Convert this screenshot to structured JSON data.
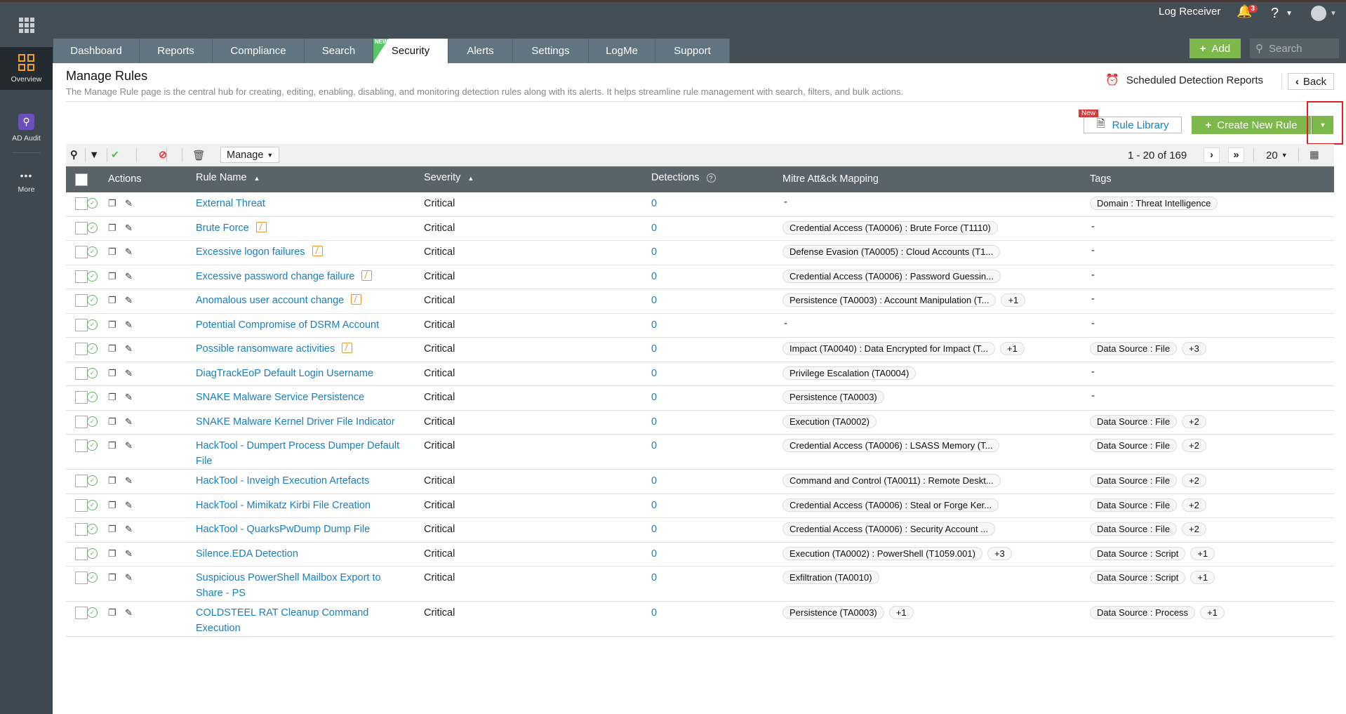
{
  "header": {
    "log_receiver": "Log Receiver",
    "notification_count": "3",
    "help": "?",
    "add_label": "Add",
    "search_placeholder": "Search"
  },
  "sidebar": {
    "items": [
      {
        "label": "Overview",
        "icon": "grid-icon",
        "active": true
      },
      {
        "label": "AD Audit",
        "icon": "ad-audit-icon"
      },
      {
        "label": "More",
        "icon": "more-icon"
      }
    ]
  },
  "tabs": [
    {
      "label": "Dashboard"
    },
    {
      "label": "Reports"
    },
    {
      "label": "Compliance"
    },
    {
      "label": "Search"
    },
    {
      "label": "Security",
      "active": true,
      "badge": "NEW"
    },
    {
      "label": "Alerts"
    },
    {
      "label": "Settings"
    },
    {
      "label": "LogMe"
    },
    {
      "label": "Support"
    }
  ],
  "page": {
    "title": "Manage Rules",
    "description": "The Manage Rule page is the central hub for creating, editing, enabling, disabling, and monitoring detection rules along with its alerts. It helps streamline rule management with search, filters, and bulk actions.",
    "scheduled_reports": "Scheduled Detection Reports",
    "back": "Back",
    "rule_library": "Rule Library",
    "rule_library_badge": "New",
    "create_rule": "Create New Rule"
  },
  "toolbar": {
    "manage": "Manage",
    "pagination": "1 - 20 of 169",
    "page_size": "20"
  },
  "columns": {
    "actions": "Actions",
    "rule_name": "Rule Name",
    "severity": "Severity",
    "detections": "Detections",
    "mitre": "Mitre Att&ck Mapping",
    "tags": "Tags"
  },
  "colors": {
    "accent_green": "#7cb84a",
    "link": "#1a7fc1",
    "header": "#434e56",
    "highlight": "#e02020"
  },
  "rows": [
    {
      "name": "External Threat",
      "threat": false,
      "severity": "Critical",
      "detections": "0",
      "mitre": [],
      "mitre_more": "",
      "tags": [
        "Domain : Threat Intelligence"
      ],
      "tags_more": ""
    },
    {
      "name": "Brute Force",
      "threat": true,
      "severity": "Critical",
      "detections": "0",
      "mitre": [
        "Credential Access (TA0006) : Brute Force (T1110)"
      ],
      "mitre_more": "",
      "tags": [],
      "tags_more": ""
    },
    {
      "name": "Excessive logon failures",
      "threat": true,
      "severity": "Critical",
      "detections": "0",
      "mitre": [
        "Defense Evasion (TA0005) : Cloud Accounts (T1..."
      ],
      "mitre_more": "",
      "tags": [],
      "tags_more": ""
    },
    {
      "name": "Excessive password change failure",
      "threat": true,
      "severity": "Critical",
      "detections": "0",
      "mitre": [
        "Credential Access (TA0006) : Password Guessin..."
      ],
      "mitre_more": "",
      "tags": [],
      "tags_more": ""
    },
    {
      "name": "Anomalous user account change",
      "threat": true,
      "severity": "Critical",
      "detections": "0",
      "mitre": [
        "Persistence (TA0003) : Account Manipulation (T..."
      ],
      "mitre_more": "+1",
      "tags": [],
      "tags_more": ""
    },
    {
      "name": "Potential Compromise of DSRM Account",
      "threat": false,
      "severity": "Critical",
      "detections": "0",
      "mitre": [],
      "mitre_more": "",
      "tags": [],
      "tags_more": ""
    },
    {
      "name": "Possible ransomware activities",
      "threat": true,
      "severity": "Critical",
      "detections": "0",
      "mitre": [
        "Impact (TA0040) : Data Encrypted for Impact (T..."
      ],
      "mitre_more": "+1",
      "tags": [
        "Data Source : File"
      ],
      "tags_more": "+3"
    },
    {
      "name": "DiagTrackEoP Default Login Username",
      "threat": false,
      "severity": "Critical",
      "detections": "0",
      "mitre": [
        "Privilege Escalation (TA0004)"
      ],
      "mitre_more": "",
      "tags": [],
      "tags_more": ""
    },
    {
      "name": "SNAKE Malware Service Persistence",
      "threat": false,
      "severity": "Critical",
      "detections": "0",
      "mitre": [
        "Persistence (TA0003)"
      ],
      "mitre_more": "",
      "tags": [],
      "tags_more": ""
    },
    {
      "name": "SNAKE Malware Kernel Driver File Indicator",
      "threat": false,
      "severity": "Critical",
      "detections": "0",
      "mitre": [
        "Execution (TA0002)"
      ],
      "mitre_more": "",
      "tags": [
        "Data Source : File"
      ],
      "tags_more": "+2"
    },
    {
      "name": "HackTool - Dumpert Process Dumper Default File",
      "threat": false,
      "severity": "Critical",
      "detections": "0",
      "mitre": [
        "Credential Access (TA0006) : LSASS Memory (T..."
      ],
      "mitre_more": "",
      "tags": [
        "Data Source : File"
      ],
      "tags_more": "+2"
    },
    {
      "name": "HackTool - Inveigh Execution Artefacts",
      "threat": false,
      "severity": "Critical",
      "detections": "0",
      "mitre": [
        "Command and Control (TA0011) : Remote Deskt..."
      ],
      "mitre_more": "",
      "tags": [
        "Data Source : File"
      ],
      "tags_more": "+2"
    },
    {
      "name": "HackTool - Mimikatz Kirbi File Creation",
      "threat": false,
      "severity": "Critical",
      "detections": "0",
      "mitre": [
        "Credential Access (TA0006) : Steal or Forge Ker..."
      ],
      "mitre_more": "",
      "tags": [
        "Data Source : File"
      ],
      "tags_more": "+2"
    },
    {
      "name": "HackTool - QuarksPwDump Dump File",
      "threat": false,
      "severity": "Critical",
      "detections": "0",
      "mitre": [
        "Credential Access (TA0006) : Security Account ..."
      ],
      "mitre_more": "",
      "tags": [
        "Data Source : File"
      ],
      "tags_more": "+2"
    },
    {
      "name": "Silence.EDA Detection",
      "threat": false,
      "severity": "Critical",
      "detections": "0",
      "mitre": [
        "Execution (TA0002) : PowerShell (T1059.001)"
      ],
      "mitre_more": "+3",
      "tags": [
        "Data Source : Script"
      ],
      "tags_more": "+1"
    },
    {
      "name": "Suspicious PowerShell Mailbox Export to Share - PS",
      "threat": false,
      "severity": "Critical",
      "detections": "0",
      "mitre": [
        "Exfiltration (TA0010)"
      ],
      "mitre_more": "",
      "tags": [
        "Data Source : Script"
      ],
      "tags_more": "+1"
    },
    {
      "name": "COLDSTEEL RAT Cleanup Command Execution",
      "threat": false,
      "severity": "Critical",
      "detections": "0",
      "mitre": [
        "Persistence (TA0003)"
      ],
      "mitre_more": "+1",
      "tags": [
        "Data Source : Process"
      ],
      "tags_more": "+1"
    }
  ],
  "empty_value": "-"
}
